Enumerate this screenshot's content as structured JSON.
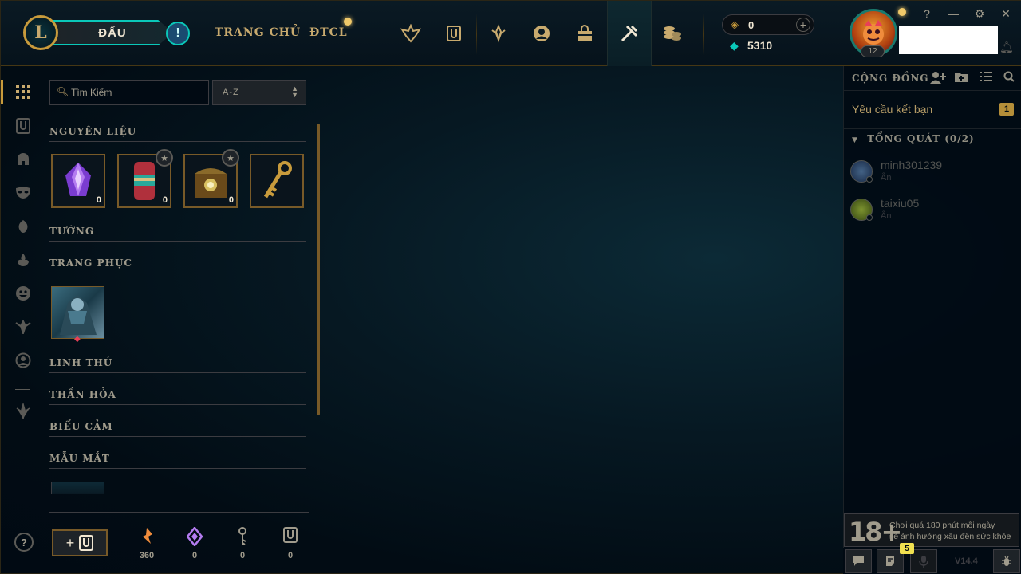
{
  "topbar": {
    "logo_letter": "L",
    "play_label": "ĐẤU",
    "alert_icon": "!",
    "nav": [
      "TRANG CHỦ",
      "ĐTCL"
    ],
    "icons": [
      "rank-icon",
      "collection-icon",
      "tft-icon",
      "profile-icon",
      "store-bag-icon",
      "loot-icon",
      "coins-icon"
    ],
    "currency": {
      "gold": "0",
      "blue_essence": "5310"
    },
    "profile": {
      "level": "12"
    },
    "window_controls": [
      "?",
      "—",
      "⚙",
      "✕"
    ]
  },
  "collection": {
    "search_placeholder": "Tìm Kiếm",
    "sort_label": "A-Z",
    "sections": {
      "materials": "NGUYÊN LIỆU",
      "champions": "TƯỚNG",
      "skins": "TRANG PHỤC",
      "companions": "LINH THÚ",
      "ward_skins": "THẦN HỎA",
      "emotes": "BIỂU CẢM",
      "eye_colors": "MẪU MẮT"
    },
    "materials": [
      {
        "name": "mythic-essence",
        "count": "0"
      },
      {
        "name": "capsule",
        "count": "0"
      },
      {
        "name": "hextech-chest",
        "count": "0"
      },
      {
        "name": "hextech-key",
        "count": ""
      }
    ],
    "resources": [
      {
        "name": "orange-essence",
        "value": "360",
        "color": "#f08c3c"
      },
      {
        "name": "mythic-essence",
        "value": "0",
        "color": "#b47cf0"
      },
      {
        "name": "key-fragment",
        "value": "0",
        "color": "#a09b8c"
      },
      {
        "name": "collection-token",
        "value": "0",
        "color": "#a09b8c"
      }
    ]
  },
  "social": {
    "header": "CỘNG ĐỒNG",
    "friend_requests_label": "Yêu cầu kết bạn",
    "friend_requests_count": "1",
    "group_label": "TỔNG QUÁT (0/2)",
    "friends": [
      {
        "name": "minh301239",
        "status": "Ẩn"
      },
      {
        "name": "taixiu05",
        "status": "Ẩn"
      }
    ],
    "age_rating": "18+",
    "age_warning_line1": "Chơi quá 180 phút mỗi ngày",
    "age_warning_line2": "sẽ ảnh hưởng xấu đến sức khỏe",
    "notification_count": "5",
    "version": "V14.4"
  }
}
